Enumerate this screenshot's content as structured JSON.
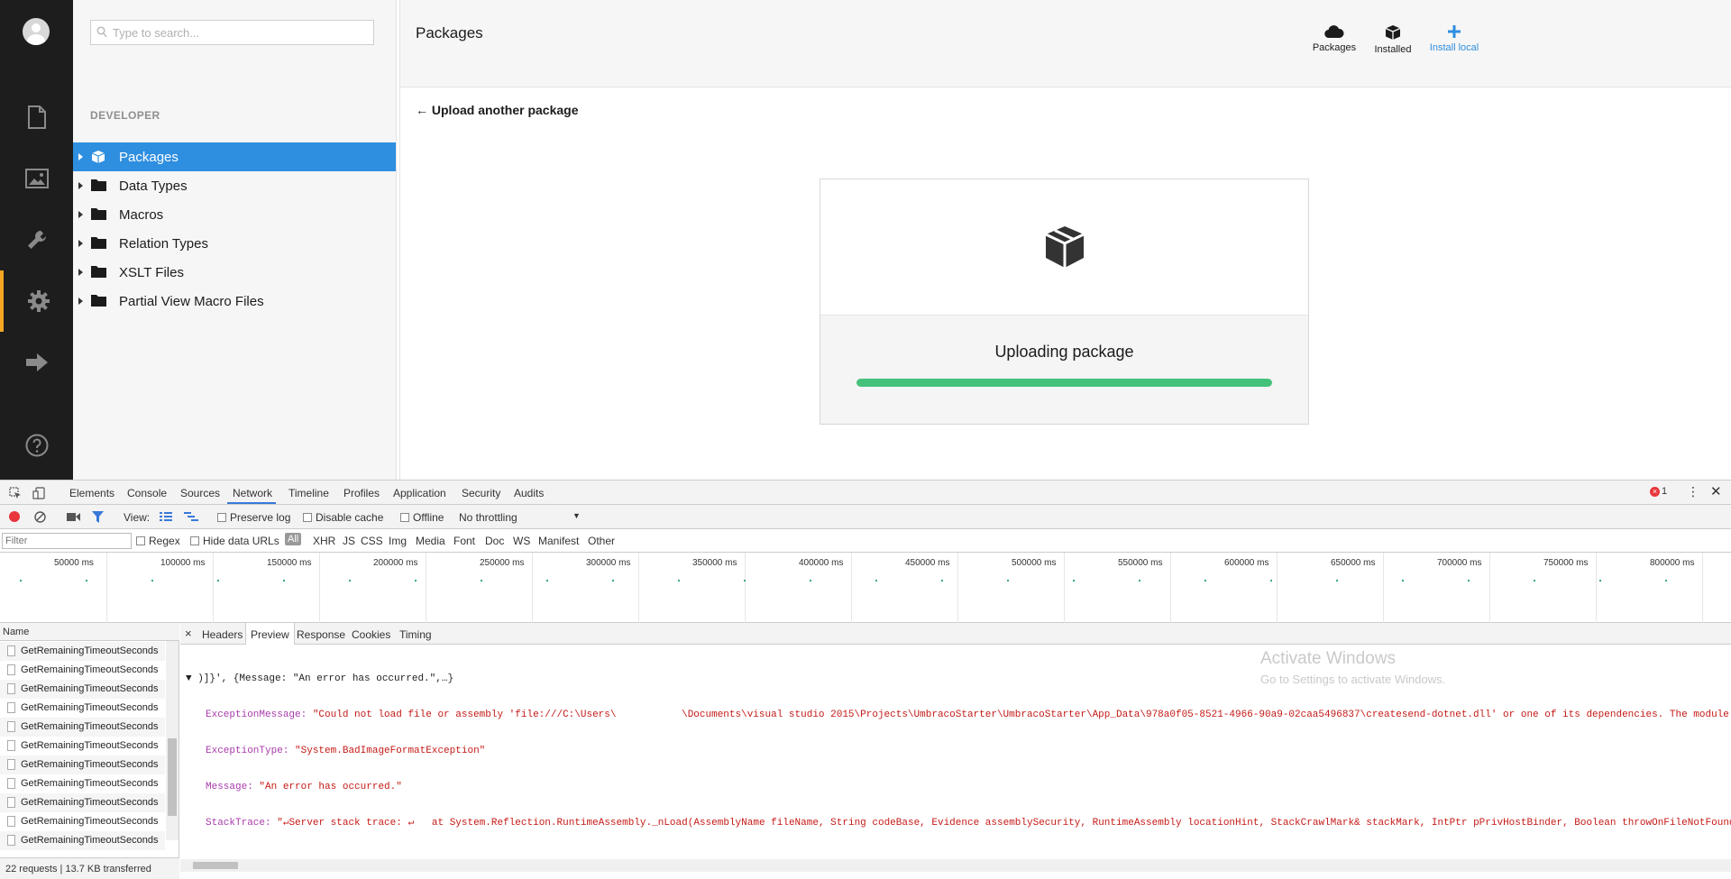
{
  "app": {
    "search_placeholder": "Type to search...",
    "section_title": "DEVELOPER",
    "tree_items": [
      {
        "label": "Packages",
        "selected": true
      },
      {
        "label": "Data Types"
      },
      {
        "label": "Macros"
      },
      {
        "label": "Relation Types"
      },
      {
        "label": "XSLT Files"
      },
      {
        "label": "Partial View Macro Files"
      }
    ],
    "page_title": "Packages",
    "header_buttons": {
      "packages": "Packages",
      "installed": "Installed",
      "install_local": "Install local"
    },
    "back_link": "← Upload another package",
    "upload_status": "Uploading package",
    "progress_percent": 100,
    "colors": {
      "accent": "#2e8ee0",
      "progress": "#44c17a",
      "rail": "#1d1d1d",
      "rail_active": "#f5a623"
    }
  },
  "devtools": {
    "tabs": [
      "Elements",
      "Console",
      "Sources",
      "Network",
      "Timeline",
      "Profiles",
      "Application",
      "Security",
      "Audits"
    ],
    "active_tab": "Network",
    "error_count": "1",
    "toolbar": {
      "view_label": "View:",
      "preserve_log": "Preserve log",
      "disable_cache": "Disable cache",
      "offline": "Offline",
      "throttling": "No throttling"
    },
    "filter": {
      "placeholder": "Filter",
      "regex": "Regex",
      "hide_data_urls": "Hide data URLs",
      "types": [
        "All",
        "XHR",
        "JS",
        "CSS",
        "Img",
        "Media",
        "Font",
        "Doc",
        "WS",
        "Manifest",
        "Other"
      ]
    },
    "timeline_labels": [
      "50000 ms",
      "100000 ms",
      "150000 ms",
      "200000 ms",
      "250000 ms",
      "300000 ms",
      "350000 ms",
      "400000 ms",
      "450000 ms",
      "500000 ms",
      "550000 ms",
      "600000 ms",
      "650000 ms",
      "700000 ms",
      "750000 ms",
      "800000 ms"
    ],
    "names_header": "Name",
    "request_names": [
      "GetRemainingTimeoutSeconds",
      "GetRemainingTimeoutSeconds",
      "GetRemainingTimeoutSeconds",
      "GetRemainingTimeoutSeconds",
      "GetRemainingTimeoutSeconds",
      "GetRemainingTimeoutSeconds",
      "GetRemainingTimeoutSeconds",
      "GetRemainingTimeoutSeconds",
      "GetRemainingTimeoutSeconds",
      "GetRemainingTimeoutSeconds",
      "GetRemainingTimeoutSeconds"
    ],
    "footer": "22 requests  |  13.7 KB transferred",
    "detail_tabs": [
      "Headers",
      "Preview",
      "Response",
      "Cookies",
      "Timing"
    ],
    "active_detail_tab": "Preview",
    "preview": {
      "line0": "▼ )]}', {Message: \"An error has occurred.\",…}",
      "exception_message_key": "ExceptionMessage: ",
      "exception_message_val": "\"Could not load file or assembly 'file:///C:\\Users\\           \\Documents\\visual studio 2015\\Projects\\UmbracoStarter\\UmbracoStarter\\App_Data\\978a0f05-8521-4966-90a9-02caa5496837\\createsend-dotnet.dll' or one of its dependencies. The module",
      "exception_type_key": "ExceptionType: ",
      "exception_type_val": "\"System.BadImageFormatException\"",
      "message_key": "Message: ",
      "message_val": "\"An error has occurred.\"",
      "stacktrace_key": "StackTrace: ",
      "stacktrace_val": "\"↵Server stack trace: ↵   at System.Reflection.RuntimeAssembly._nLoad(AssemblyName fileName, String codeBase, Evidence assemblySecurity, RuntimeAssembly locationHint, StackCrawlMark& stackMark, IntPtr pPrivHostBinder, Boolean throwOnFileNotFound"
    }
  },
  "watermark": {
    "line1": "Activate Windows",
    "line2": "Go to Settings to activate Windows."
  }
}
